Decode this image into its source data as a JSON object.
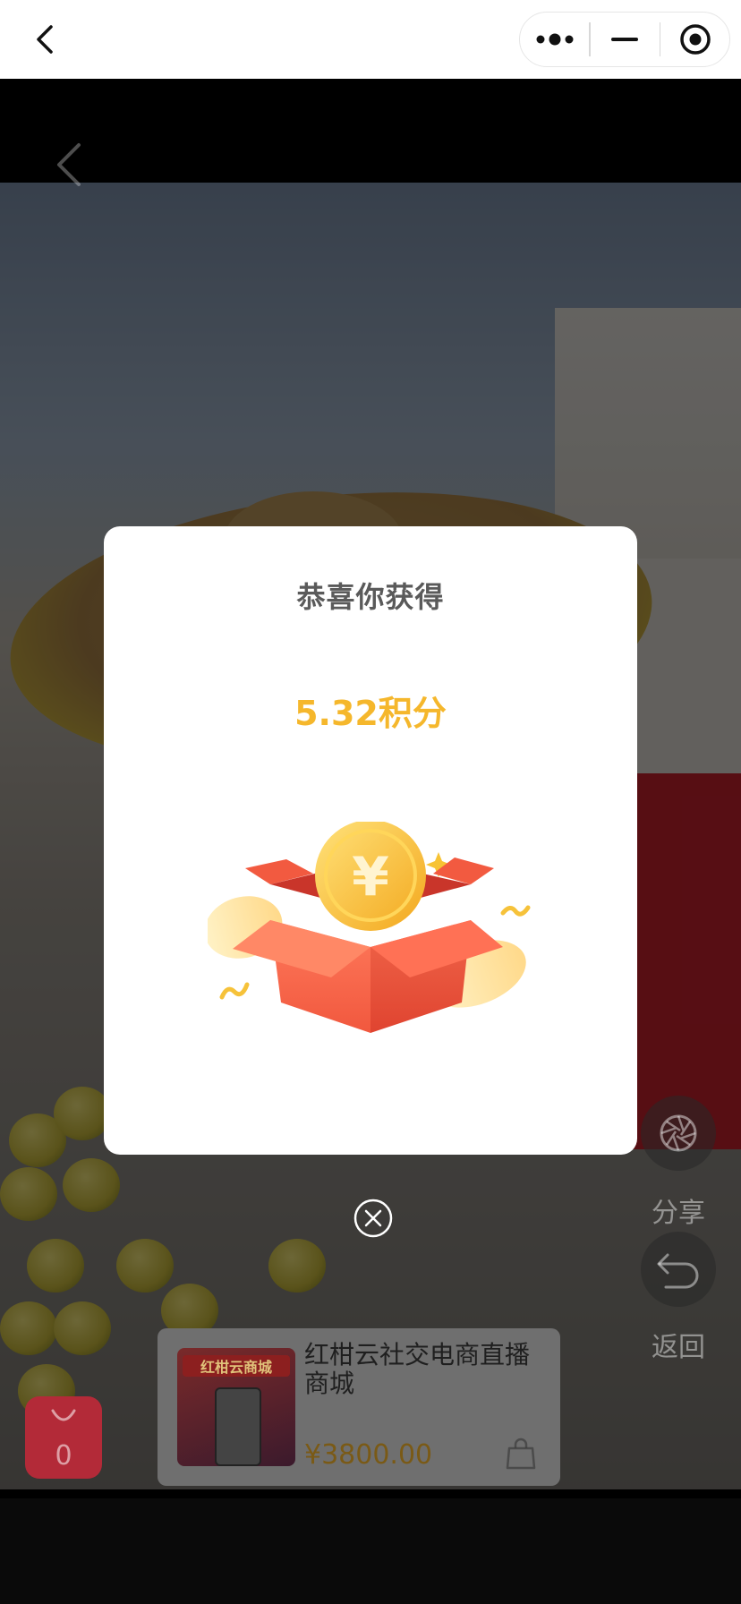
{
  "topbar": {
    "back_icon": "chevron-left-icon",
    "capsule": [
      "more-dots-icon",
      "minimize-icon",
      "close-circle-icon"
    ]
  },
  "video": {
    "back_icon": "chevron-left-icon",
    "side_actions": [
      {
        "icon": "shutter-icon",
        "label": "分享"
      },
      {
        "icon": "undo-icon",
        "label": "返回"
      }
    ],
    "cart_count": "0"
  },
  "product": {
    "thumb_banner": "红柑云商城",
    "name": "红柑云社交电商直播商城",
    "price": "¥3800.00"
  },
  "modal": {
    "title": "恭喜你获得",
    "points": "5.32积分",
    "illustration_icon": "gift-box-coin-icon",
    "close_icon": "close-circle-icon"
  },
  "colors": {
    "points": "#f5b72c",
    "title": "#5a5a5a",
    "box": "#f15a46",
    "coin": "#f7c334"
  }
}
